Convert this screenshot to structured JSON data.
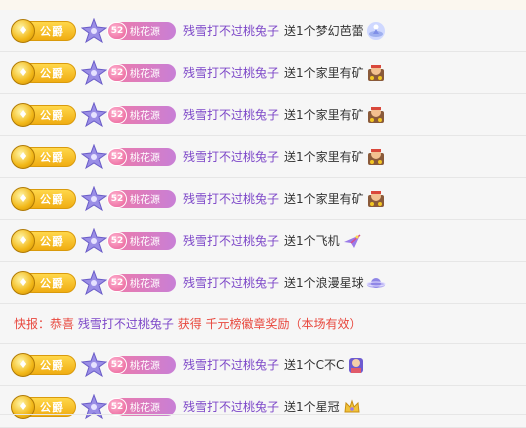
{
  "badges": {
    "noble_label": "公爵",
    "fan_level": "52",
    "fan_club": "桃花源"
  },
  "messages": [
    {
      "type": "gift",
      "user": "残雪打不过桃兔子",
      "action": "送1个梦幻芭蕾",
      "gift_icon": "ballet-gift-icon"
    },
    {
      "type": "gift",
      "user": "残雪打不过桃兔子",
      "action": "送1个家里有矿",
      "gift_icon": "mine-gift-icon"
    },
    {
      "type": "gift",
      "user": "残雪打不过桃兔子",
      "action": "送1个家里有矿",
      "gift_icon": "mine-gift-icon"
    },
    {
      "type": "gift",
      "user": "残雪打不过桃兔子",
      "action": "送1个家里有矿",
      "gift_icon": "mine-gift-icon"
    },
    {
      "type": "gift",
      "user": "残雪打不过桃兔子",
      "action": "送1个家里有矿",
      "gift_icon": "mine-gift-icon"
    },
    {
      "type": "gift",
      "user": "残雪打不过桃兔子",
      "action": "送1个飞机",
      "gift_icon": "airplane-gift-icon"
    },
    {
      "type": "gift",
      "user": "残雪打不过桃兔子",
      "action": "送1个浪漫星球",
      "gift_icon": "planet-gift-icon"
    },
    {
      "type": "notice",
      "prefix": "快报：恭喜",
      "user": "残雪打不过桃兔子",
      "suffix": "获得 千元榜徽章奖励（本场有效）"
    },
    {
      "type": "gift",
      "user": "残雪打不过桃兔子",
      "action": "送1个C不C",
      "gift_icon": "cbc-gift-icon"
    },
    {
      "type": "gift",
      "user": "残雪打不过桃兔子",
      "action": "送1个星冠",
      "gift_icon": "star-crown-gift-icon"
    }
  ]
}
